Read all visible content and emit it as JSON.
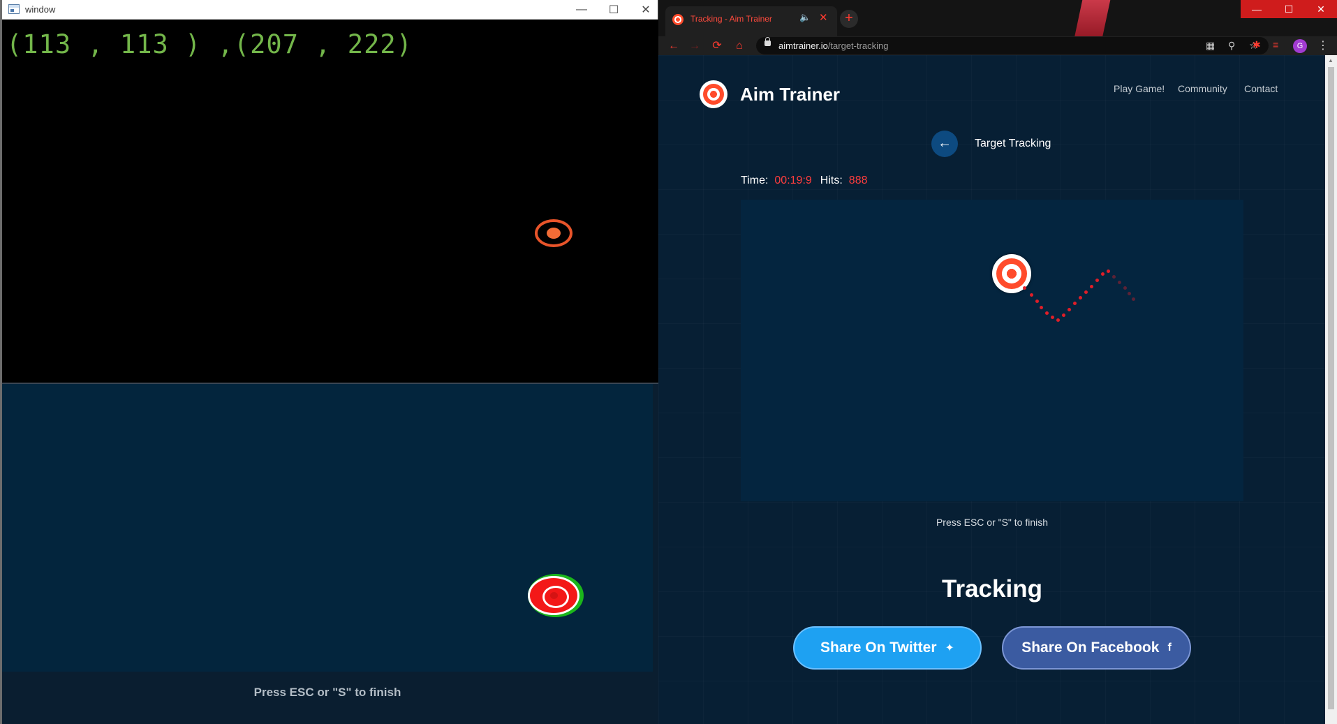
{
  "cv_window": {
    "title": "window",
    "coords_text": "(113 , 113 ) ,(207 , 222)",
    "press_text": "Press ESC or \"S\" to finish"
  },
  "browser": {
    "tab_title": "Tracking - Aim Trainer",
    "url_host": "aimtrainer.io",
    "url_path": "/target-tracking",
    "avatar_letter": "G"
  },
  "site": {
    "brand": "Aim Trainer",
    "nav": [
      "Play Game!",
      "Community",
      "Contact"
    ],
    "page_heading": "Target Tracking",
    "time_label": "Time:",
    "time_value": "00:19:9",
    "hits_label": "Hits:",
    "hits_value": "888",
    "press_text": "Press ESC or \"S\" to finish",
    "result_title": "Tracking",
    "share_twitter": "Share On Twitter",
    "share_facebook": "Share On Facebook"
  },
  "colors": {
    "accent_red": "#ff3d3d",
    "twitter_blue": "#1ea1f2",
    "facebook_blue": "#3b5ba1",
    "coords_green": "#73b64a"
  }
}
